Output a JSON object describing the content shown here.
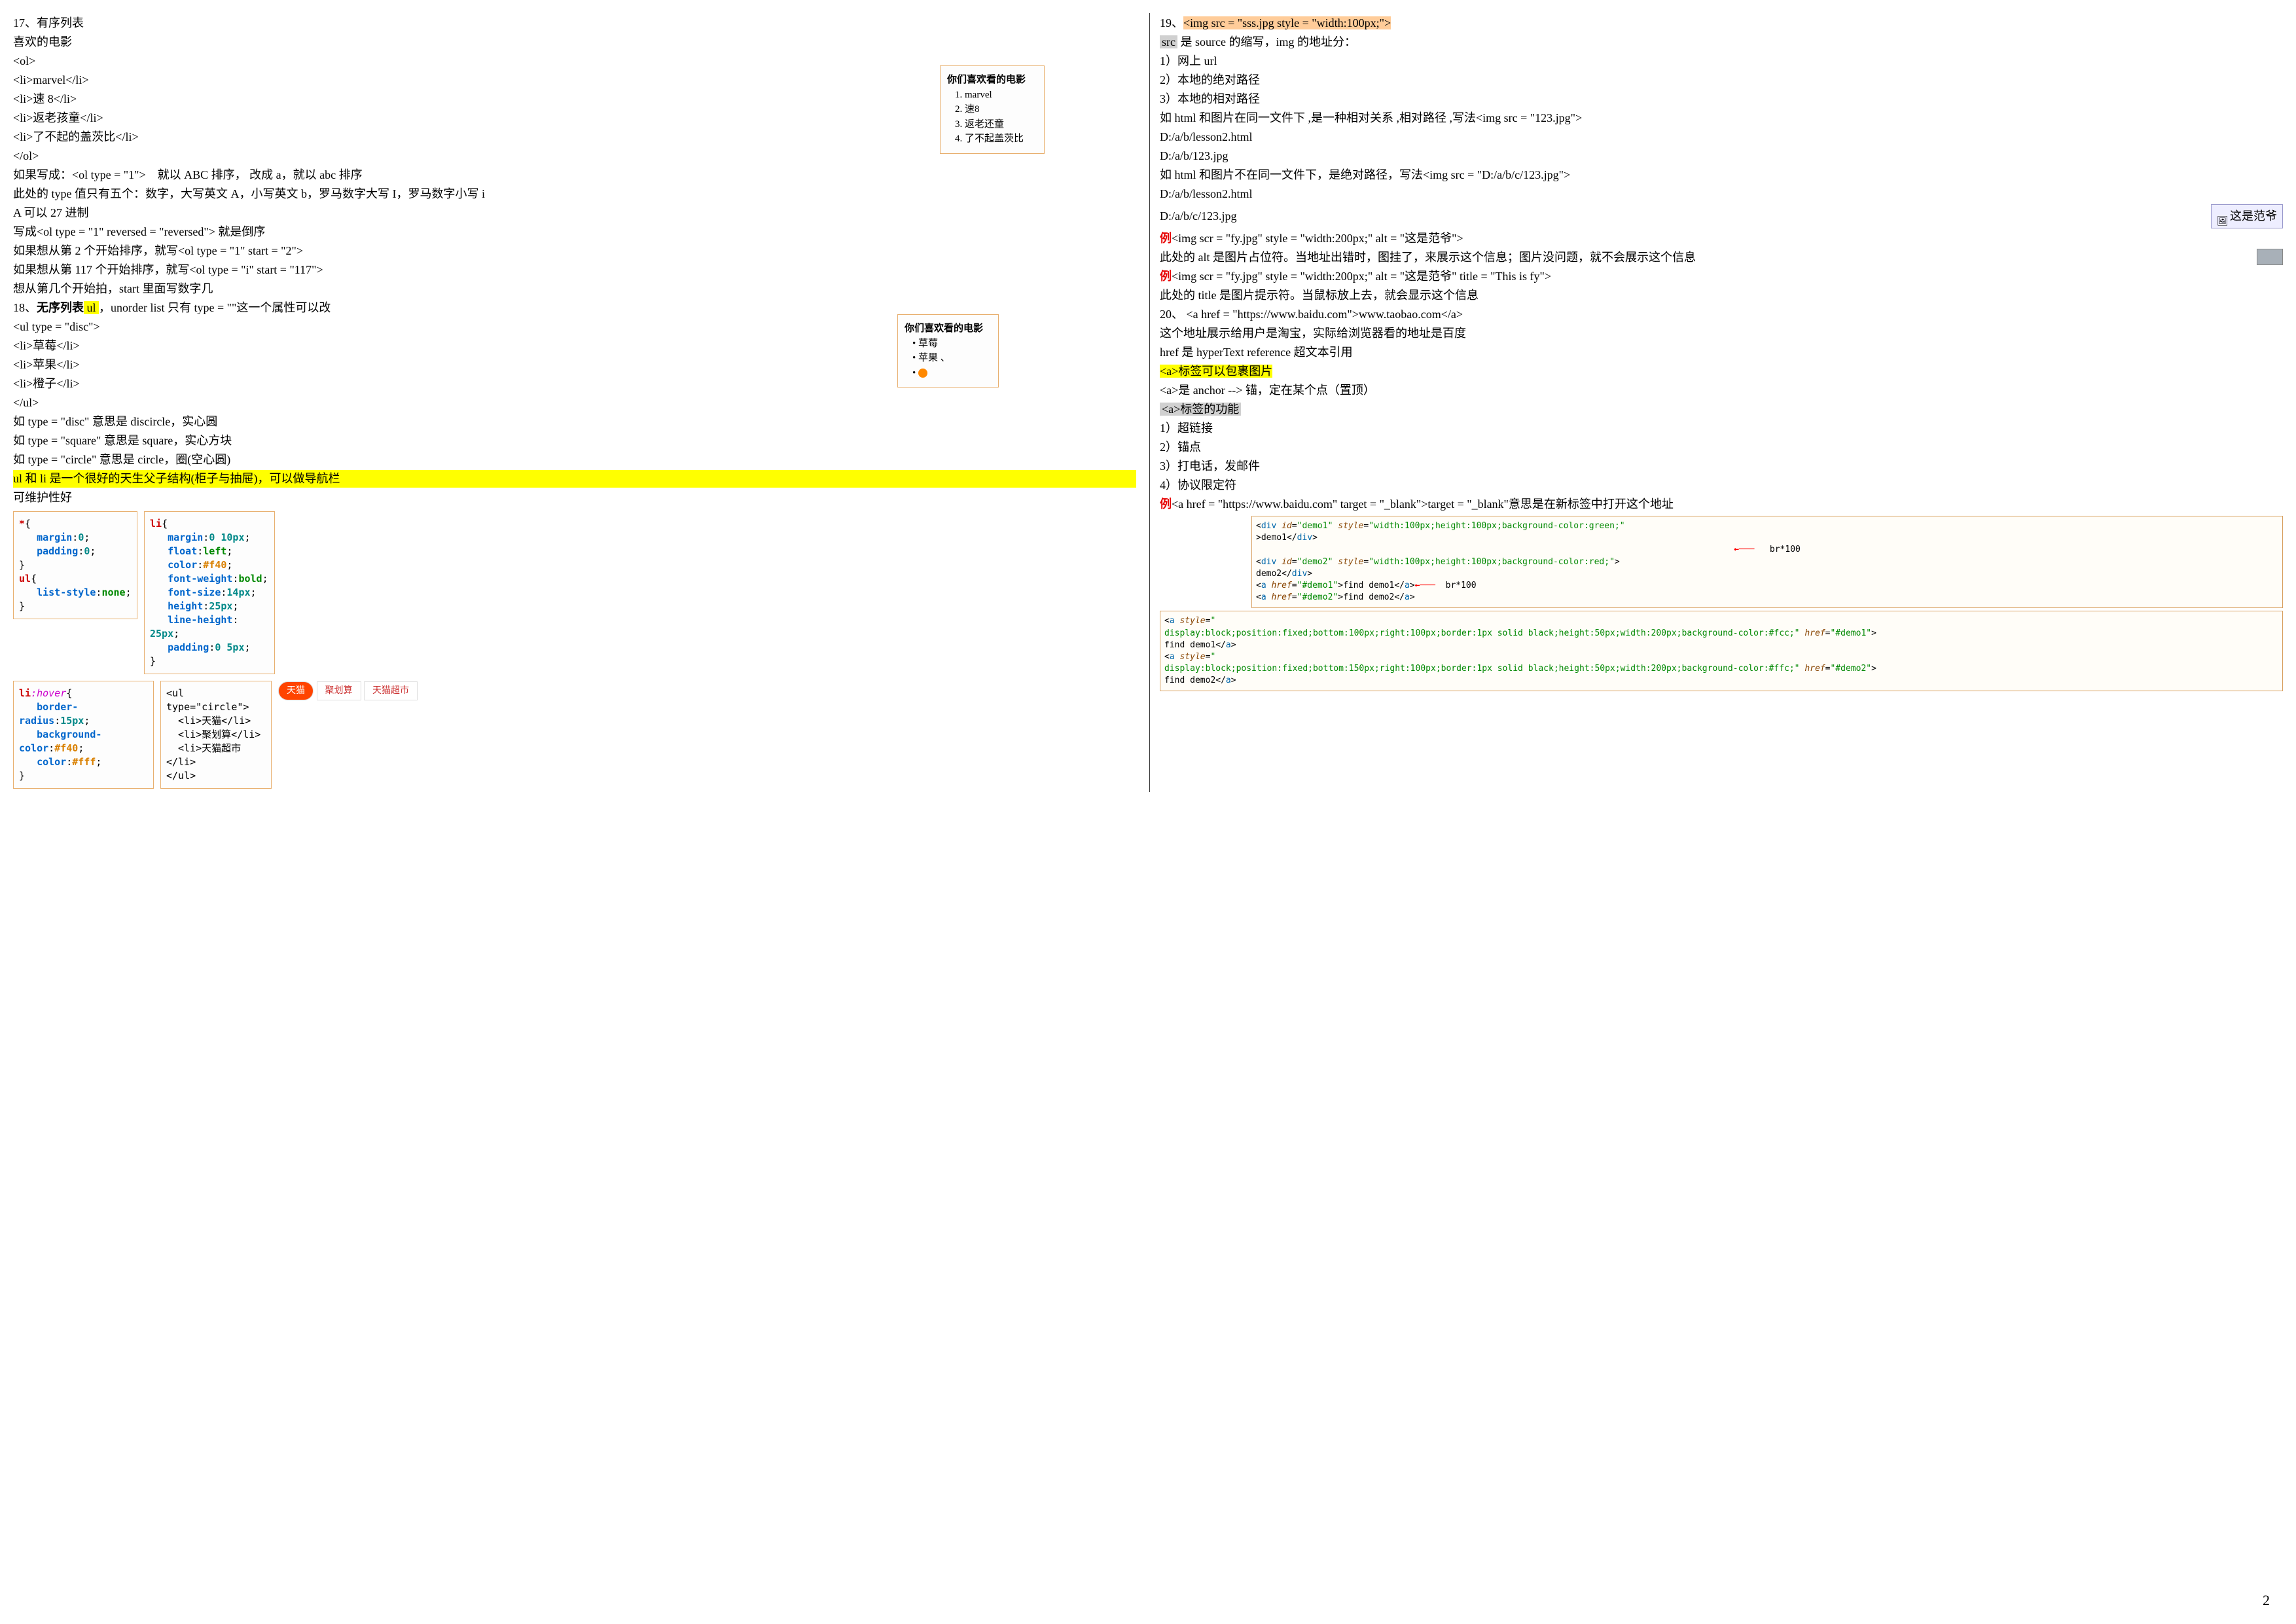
{
  "pageNum": "2",
  "left": {
    "l01": "17、有序列表",
    "l02": "喜欢的电影",
    "l03": "<ol>",
    "l04": "<li>marvel</li>",
    "l05": "<li>速 8</li>",
    "l06": "<li>返老孩童</li>",
    "l07": "<li>了不起的盖茨比</li>",
    "l08": "</ol>",
    "l09a": "如果写成：<ol type = \"1\">",
    "l09b": "就以 ABC 排序， 改成 a，就以 abc 排序",
    "l10": "此处的 type 值只有五个：数字，大写英文 A，小写英文 b，罗马数字大写 I，罗马数字小写 i",
    "l11": "A 可以 27 进制",
    "l12": "写成<ol type = \"1\" reversed = \"reversed\"> 就是倒序",
    "l13": "如果想从第 2 个开始排序，就写<ol type = \"1\" start = \"2\">",
    "l14": "如果想从第 117 个开始排序，就写<ol type = \"i\" start = \"117\">",
    "l15": "想从第几个开始拍，start 里面写数字几",
    "l16a": "18、",
    "l16b": "无序列表",
    "l16c": " ul ",
    "l16d": "，unorder list 只有 type = \"\"这一个属性可以改",
    "l17": "<ul type = \"disc\">",
    "l18": "<li>草莓</li>",
    "l19": "<li>苹果</li>",
    "l20": "<li>橙子</li>",
    "l21": "</ul>",
    "l22": "如 type =   \"disc\"   意思是 discircle，实心圆",
    "l23": "如 type =   \"square\"   意思是 square，实心方块",
    "l24": "如 type =   \"circle\"   意思是 circle，圈(空心圆)",
    "l25": "ul 和 li 是一个很好的天生父子结构(柜子与抽屉)，可以做导航栏",
    "l26": "可维护性好",
    "box1": {
      "title": "你们喜欢看的电影",
      "i1": "1. marvel",
      "i2": "2. 速8",
      "i3": "3. 返老还童",
      "i4": "4. 了不起盖茨比"
    },
    "box2": {
      "title": "你们喜欢看的电影",
      "i1": "草莓",
      "i2": "苹果",
      "i3": "● "
    },
    "code1": {
      "l1": "*{",
      "l2": "margin:0;",
      "l3": "padding:0;",
      "l4": "}",
      "l5": "ul{",
      "l6": "list-style:none;",
      "l7": "}"
    },
    "code2": {
      "l1": "li{",
      "l2": "margin:0 10px;",
      "l3": "float:left;",
      "l4": "color:#f40;",
      "l5": "font-weight:bold;",
      "l6": "font-size:14px;",
      "l7": "height:25px;",
      "l8": "line-height: 25px;",
      "l9": "padding:0 5px;",
      "l10": "}"
    },
    "code3": {
      "l1": "li:hover{",
      "l2": "border-radius:15px;",
      "l3": "background-color:#f40;",
      "l4": "color:#fff;",
      "l5": "}"
    },
    "code4": {
      "l1": "<ul type=\"circle\">",
      "l2": "<li>天猫</li>",
      "l3": "<li>聚划算</li>",
      "l4": "<li>天猫超市</li>",
      "l5": "</ul>"
    },
    "menu": {
      "m1": "天猫",
      "m2": "聚划算",
      "m3": "天猫超市"
    }
  },
  "right": {
    "l01a": "19、",
    "l01b": "<img src = \"sss.jpg style = \"width:100px;\">",
    "l02a": "src",
    "l02b": " 是 source 的缩写，img 的地址分：",
    "l03": "1）网上 url",
    "l04": "2）本地的绝对路径",
    "l05": "3）本地的相对路径",
    "l06": "如 html 和图片在同一文件下 ,是一种相对关系 ,相对路径 ,写法<img src = \"123.jpg\">",
    "l07": "D:/a/b/lesson2.html",
    "l08": "D:/a/b/123.jpg",
    "l09": "如 html 和图片不在同一文件下，是绝对路径，写法<img src = \"D:/a/b/c/123.jpg\">",
    "l10": "D:/a/b/lesson2.html",
    "l11": "D:/a/b/c/123.jpg",
    "placeholder": "这是范爷",
    "l12a": "例",
    "l12b": "<img scr = \"fy.jpg\" style = \"width:200px;\" alt = \"这是范爷\">",
    "l13": "此处的 alt 是图片占位符。当地址出错时，图挂了，来展示这个信息；图片没问题，就不会展示这个信息",
    "l14a": "例",
    "l14b": "<img scr = \"fy.jpg\" style = \"width:200px;\" alt = \"这是范爷\" title = \"This is fy\">",
    "l15": "此处的 title 是图片提示符。当鼠标放上去，就会显示这个信息",
    "l16": "20、 <a href = \"https://www.baidu.com\">www.taobao.com</a>",
    "l17": "这个地址展示给用户是淘宝，实际给浏览器看的地址是百度",
    "l18": "href 是 hyperText reference 超文本引用",
    "l19a": "<a>",
    "l19b": "标签可以包裹图片",
    "l20": "<a>是 anchor --> 锚，定在某个点（置顶）",
    "l21a": "<a>",
    "l21b": "标签的功能",
    "l22": "1）超链接",
    "l23": "2）锚点",
    "l24": "3）打电话，发邮件",
    "l25": "4）协议限定符",
    "l26a": "例",
    "l26b": "<a href = \"https://www.baidu.com\" target = \"_blank\">target = \"_blank\"意思是在新标签中打开这个地址",
    "syntax1": {
      "l1": "<div id=\"demo1\" style=\"width:100px;height:100px;background-color:green;\">demo1</div>",
      "note1": "br*100",
      "l2": "<div id=\"demo2\" style=\"width:100px;height:100px;background-color:red;\">demo2</div>",
      "l3": "<a href=\"#demo1\">find demo1</a>",
      "note2": "br*100",
      "l4": "<a href=\"#demo2\">find demo2</a>"
    },
    "syntax2": {
      "l1": "<a style=\"",
      "l2": "display:block;position:fixed;bottom:100px;right:100px;border:1px solid black;height:50px;width:200px;background-color:#fcc;\" href=\"#demo1\">",
      "l3": "find demo1</a>",
      "l4": "<a style=\"",
      "l5": "display:block;position:fixed;bottom:150px;right:100px;border:1px solid black;height:50px;width:200px;background-color:#ffc;\" href=\"#demo2\">",
      "l6": "find demo2</a>"
    }
  }
}
